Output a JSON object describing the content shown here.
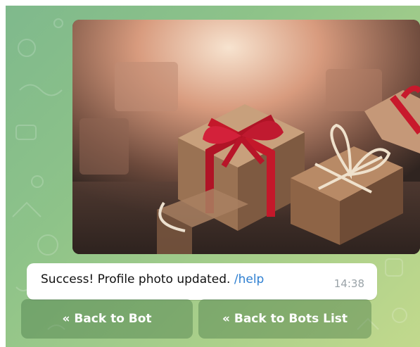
{
  "message": {
    "text": "Success! Profile photo updated.",
    "command": "/help",
    "time": "14:38"
  },
  "keyboard": {
    "buttons": [
      {
        "label": "« Back to Bot"
      },
      {
        "label": "« Back to Bots List"
      }
    ]
  },
  "colors": {
    "link": "#2e7fd1",
    "bubble": "#ffffff",
    "button_overlay": "#4a7a4a"
  },
  "icons": {
    "photo": "gift-boxes-photo"
  }
}
